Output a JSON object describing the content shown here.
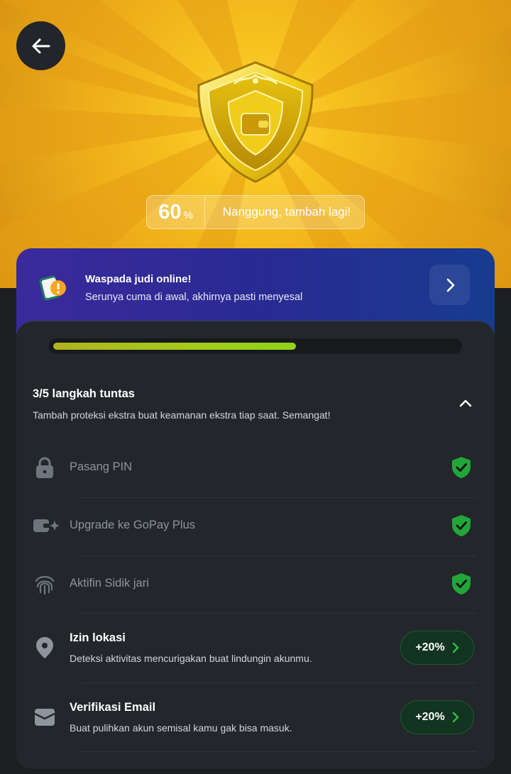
{
  "header": {
    "back_icon": "arrow-left-icon",
    "badge_icon": "gold-shield-wallet-icon",
    "score_value": "60",
    "score_unit": "%",
    "score_message": "Nanggung, tambah lagi!"
  },
  "promo": {
    "icon": "warning-card-icon",
    "title": "Waspada judi online!",
    "subtitle": "Serunya cuma di awal, akhirnya pasti menyesal",
    "arrow_icon": "chevron-right-icon"
  },
  "progress": {
    "completed_steps": 3,
    "total_steps": 5,
    "fraction": 0.6
  },
  "steps": {
    "title": "3/5 langkah tuntas",
    "subtitle": "Tambah proteksi ekstra buat keamanan ekstra tiap saat. Semangat!",
    "items": [
      {
        "label": "Pasang PIN",
        "icon": "lock-icon",
        "status": "done"
      },
      {
        "label": "Upgrade ke GoPay Plus",
        "icon": "wallet-plus-icon",
        "status": "done"
      },
      {
        "label": "Aktifin Sidik jari",
        "icon": "fingerprint-icon",
        "status": "done"
      },
      {
        "label": "Izin lokasi",
        "description": "Deteksi aktivitas mencurigakan buat lindungin akunmu.",
        "icon": "location-pin-icon",
        "status": "todo",
        "boost": "+20%"
      },
      {
        "label": "Verifikasi Email",
        "description": "Buat pulihkan akun semisal kamu gak bisa masuk.",
        "icon": "envelope-icon",
        "status": "todo",
        "boost": "+20%"
      }
    ]
  },
  "colors": {
    "hero": "#f2b51c",
    "promo": "#2a2a93",
    "card": "#23272b",
    "success": "#22a63a",
    "boost_bg": "#123421"
  }
}
